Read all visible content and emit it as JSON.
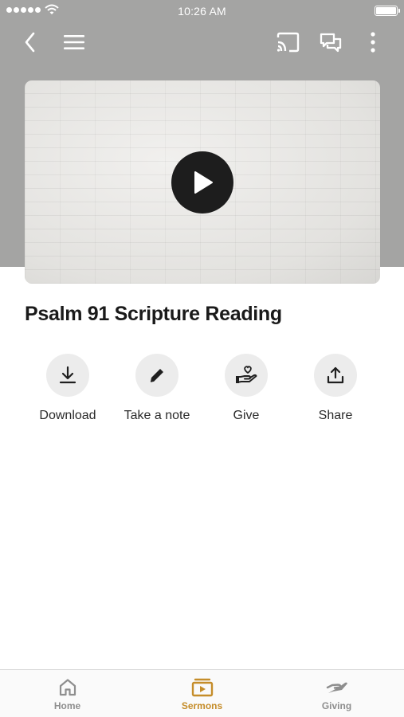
{
  "status_bar": {
    "time": "10:26 AM"
  },
  "nav": {
    "icons": [
      "back-chevron-icon",
      "menu-icon",
      "cast-icon",
      "chat-icon",
      "more-vertical-icon"
    ]
  },
  "video": {
    "play_icon": "play-icon"
  },
  "sermon": {
    "title": "Psalm 91 Scripture Reading"
  },
  "actions": [
    {
      "label": "Download",
      "icon": "download-icon"
    },
    {
      "label": "Take a note",
      "icon": "pencil-icon"
    },
    {
      "label": "Give",
      "icon": "give-heart-hand-icon"
    },
    {
      "label": "Share",
      "icon": "share-icon"
    }
  ],
  "tabbar": {
    "tabs": [
      {
        "label": "Home",
        "icon": "home-icon",
        "active": false
      },
      {
        "label": "Sermons",
        "icon": "sermons-icon",
        "active": true
      },
      {
        "label": "Giving",
        "icon": "giving-icon",
        "active": false
      }
    ]
  },
  "colors": {
    "header_gray": "#a4a4a3",
    "accent_active": "#c58d2a",
    "inactive_tab": "#8e8e8e",
    "action_circle": "#ececec"
  }
}
